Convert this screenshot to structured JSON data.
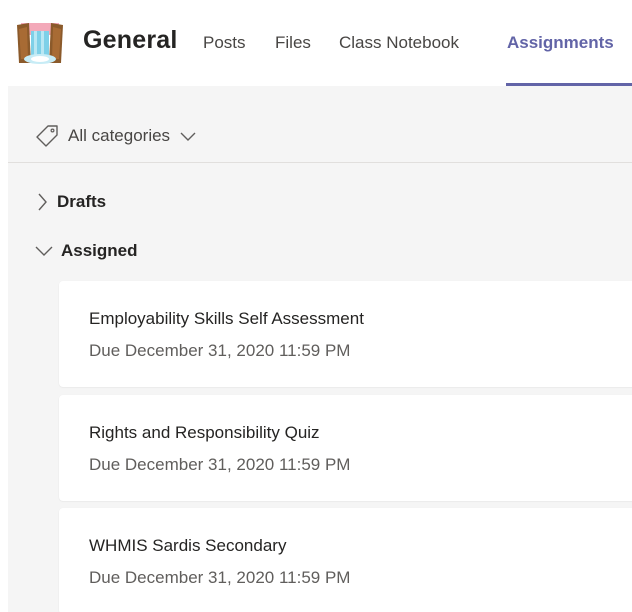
{
  "header": {
    "team_name": "General",
    "tabs": [
      {
        "label": "Posts",
        "active": false
      },
      {
        "label": "Files",
        "active": false
      },
      {
        "label": "Class Notebook",
        "active": false
      },
      {
        "label": "Assignments",
        "active": true
      }
    ],
    "accent_color": "#6264a7"
  },
  "filter": {
    "label": "All categories",
    "icon": "tag-icon"
  },
  "sections": [
    {
      "label": "Drafts",
      "expanded": false
    },
    {
      "label": "Assigned",
      "expanded": true
    }
  ],
  "assignments": [
    {
      "title": "Employability Skills Self Assessment",
      "due": "Due December 31, 2020 11:59 PM"
    },
    {
      "title": "Rights and Responsibility Quiz",
      "due": "Due December 31, 2020 11:59 PM"
    },
    {
      "title": "WHMIS Sardis Secondary",
      "due": "Due December 31, 2020 11:59 PM"
    }
  ]
}
